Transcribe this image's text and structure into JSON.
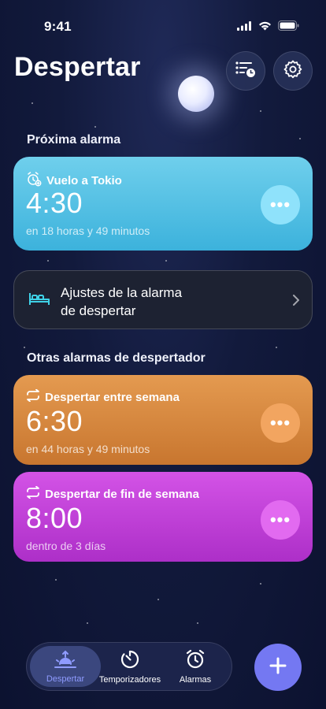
{
  "status_bar": {
    "time": "9:41"
  },
  "header": {
    "title": "Despertar"
  },
  "next_alarm": {
    "section_label": "Próxima alarma",
    "name": "Vuelo a Tokio",
    "time": "4:30",
    "subtitle": "en 18 horas y 49 minutos",
    "more_label": "•••"
  },
  "wake_settings": {
    "label_line1": "Ajustes de la alarma",
    "label_line2": "de despertar"
  },
  "other_alarms": {
    "section_label": "Otras alarmas de despertador",
    "items": [
      {
        "name": "Despertar entre semana",
        "time": "6:30",
        "subtitle": "en 44 horas y 49 minutos",
        "more_label": "•••"
      },
      {
        "name": "Despertar de fin de semana",
        "time": "8:00",
        "subtitle": "dentro de 3 días",
        "more_label": "•••"
      }
    ]
  },
  "tabs": [
    {
      "label": "Despertar",
      "icon": "sunrise-icon",
      "active": true
    },
    {
      "label": "Temporizadores",
      "icon": "timer-icon",
      "active": false
    },
    {
      "label": "Alarmas",
      "icon": "alarm-clock-icon",
      "active": false
    }
  ],
  "fab": {
    "label": "+"
  },
  "colors": {
    "accent": "#7478f2",
    "next_card": "#3cb2dc",
    "weekday_card": "#d9883f",
    "weekend_card": "#c240d8"
  }
}
